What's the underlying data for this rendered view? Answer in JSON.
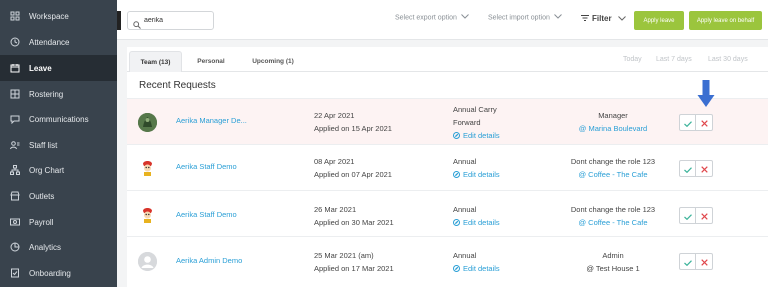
{
  "sidebar": {
    "items": [
      {
        "label": "Workspace",
        "icon": "workspace-icon",
        "active": false
      },
      {
        "label": "Attendance",
        "icon": "attendance-icon",
        "active": false
      },
      {
        "label": "Leave",
        "icon": "calendar-icon",
        "active": true
      },
      {
        "label": "Rostering",
        "icon": "rostering-icon",
        "active": false
      },
      {
        "label": "Communications",
        "icon": "chat-icon",
        "active": false
      },
      {
        "label": "Staff list",
        "icon": "staff-list-icon",
        "active": false
      },
      {
        "label": "Org Chart",
        "icon": "org-chart-icon",
        "active": false
      },
      {
        "label": "Outlets",
        "icon": "outlets-icon",
        "active": false
      },
      {
        "label": "Payroll",
        "icon": "payroll-icon",
        "active": false
      },
      {
        "label": "Analytics",
        "icon": "analytics-icon",
        "active": false
      },
      {
        "label": "Onboarding",
        "icon": "onboarding-icon",
        "active": false
      }
    ]
  },
  "header": {
    "search": {
      "value": "aerika"
    },
    "export_label": "Select export option",
    "import_label": "Select import option",
    "filter_label": "Filter",
    "apply_leave_label": "Apply leave",
    "apply_on_behalf_label": "Apply leave on behalf"
  },
  "tabs": [
    {
      "label": "Team (13)",
      "active": true
    },
    {
      "label": "Personal",
      "active": false
    },
    {
      "label": "Upcoming (1)",
      "active": false
    }
  ],
  "ranges": [
    "Today",
    "Last 7 days",
    "Last 30 days"
  ],
  "section_title": "Recent Requests",
  "requests": [
    {
      "name": "Aerika Manager De...",
      "date": "22 Apr 2021",
      "applied": "Applied on 15 Apr 2021",
      "type_line1": "Annual Carry",
      "type_line2": "Forward",
      "edit": "Edit details",
      "role": "Manager",
      "location": "@ Marina Boulevard",
      "location_link": true,
      "avatar": "photo"
    },
    {
      "name": "Aerika Staff Demo",
      "date": "08 Apr 2021",
      "applied": "Applied on 07 Apr 2021",
      "type_line1": "Annual",
      "type_line2": "",
      "edit": "Edit details",
      "role": "Dont change the role 123",
      "location": "@ Coffee - The Cafe",
      "location_link": true,
      "avatar": "cartoon"
    },
    {
      "name": "Aerika Staff Demo",
      "date": "26 Mar 2021",
      "applied": "Applied on 30 Mar 2021",
      "type_line1": "Annual",
      "type_line2": "",
      "edit": "Edit details",
      "role": "Dont change the role 123",
      "location": "@ Coffee - The Cafe",
      "location_link": true,
      "avatar": "cartoon"
    },
    {
      "name": "Aerika Admin Demo",
      "date": "25 Mar 2021 (am)",
      "applied": "Applied on 17 Mar 2021",
      "type_line1": "Annual",
      "type_line2": "",
      "edit": "Edit details",
      "role": "Admin",
      "location": "@ Test House 1",
      "location_link": false,
      "avatar": "placeholder"
    }
  ],
  "colors": {
    "sidebar": "#39434d",
    "sidebar_active": "#262d34",
    "accent_green": "#9bc53d",
    "link_blue": "#2a9fd6",
    "approve_green": "#3cb39a",
    "reject_red": "#e0474c",
    "annotation_arrow": "#3b6fd1"
  }
}
